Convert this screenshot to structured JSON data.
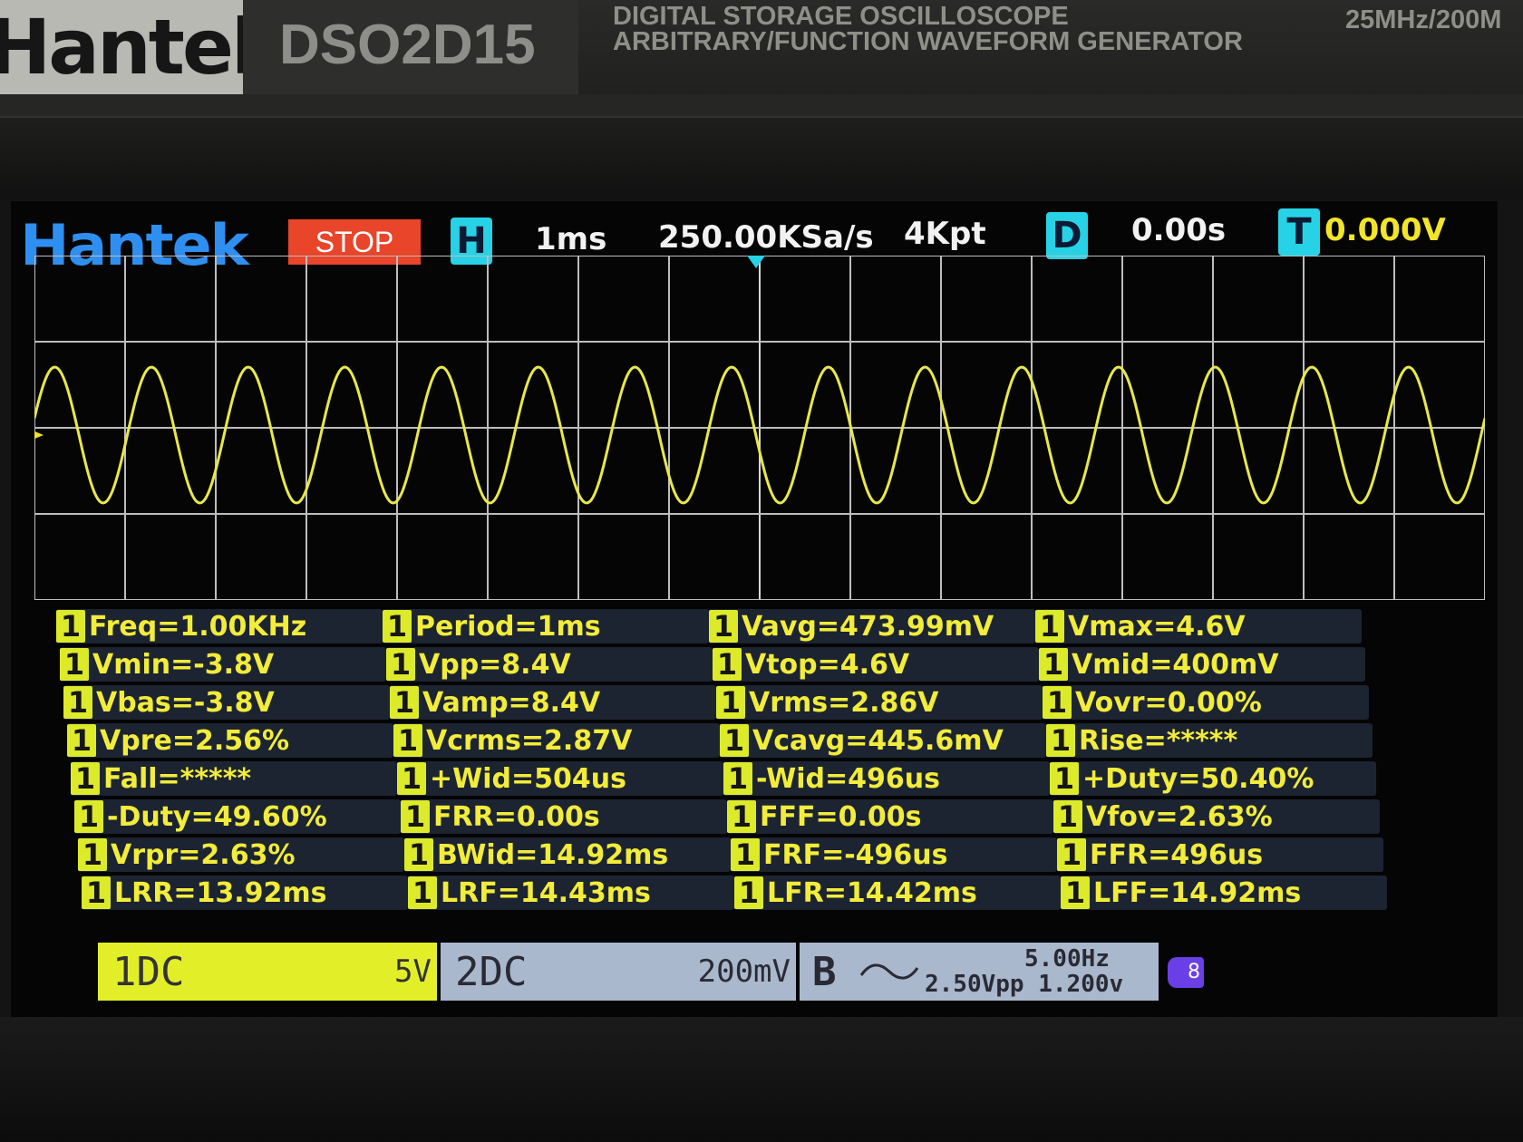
{
  "device": {
    "brand": "Hantek",
    "model": "DSO2D15",
    "subtitle_line1": "DIGITAL STORAGE OSCILLOSCOPE",
    "subtitle_line2": "ARBITRARY/FUNCTION WAVEFORM GENERATOR",
    "spec_right": "25MHz/200M"
  },
  "status_bar": {
    "logo": "Hantek",
    "run_state": "STOP",
    "horizontal_chip": "H",
    "timebase": "1ms",
    "sample_rate": "250.00KSa/s",
    "memory_depth": "4Kpt",
    "delay_chip": "D",
    "delay": "0.00s",
    "trigger_chip": "T",
    "trigger_level": "0.000V"
  },
  "waveform": {
    "channel": "1",
    "shape": "sine",
    "color": "#e8e84a",
    "cycles_visible": 15,
    "trigger_marker": "T"
  },
  "measurements": {
    "channel_badge": "1",
    "columns": [
      [
        "Freq=1.00KHz",
        "Vmin=-3.8V",
        "Vbas=-3.8V",
        "Vpre=2.56%",
        "Fall=*****",
        "-Duty=49.60%",
        "Vrpr=2.63%",
        "LRR=13.92ms"
      ],
      [
        "Period=1ms",
        "Vpp=8.4V",
        "Vamp=8.4V",
        "Vcrms=2.87V",
        "+Wid=504us",
        "FRR=0.00s",
        "BWid=14.92ms",
        "LRF=14.43ms"
      ],
      [
        "Vavg=473.99mV",
        "Vtop=4.6V",
        "Vrms=2.86V",
        "Vcavg=445.6mV",
        "-Wid=496us",
        "FFF=0.00s",
        "FRF=-496us",
        "LFR=14.42ms"
      ],
      [
        "Vmax=4.6V",
        "Vmid=400mV",
        "Vovr=0.00%",
        "Rise=*****",
        "+Duty=50.40%",
        "Vfov=2.63%",
        "FFR=496us",
        "LFF=14.92ms"
      ]
    ]
  },
  "channels": {
    "ch1": {
      "name": "1DC",
      "scale": "5V"
    },
    "ch2": {
      "name": "2DC",
      "scale": "200mV"
    },
    "generator": {
      "name": "B",
      "frequency": "5.00Hz",
      "amplitude": "2.50Vpp",
      "offset": "1.200v"
    }
  },
  "usb_indicator": "8",
  "colors": {
    "logo": "#2f8ff0",
    "stop": "#e8452a",
    "chip": "#27d2e6",
    "trace": "#e8e84a",
    "measure_text": "#f2ec3a",
    "ch1_bar": "#e2ef28",
    "ch2_bar": "#a9b8cc"
  }
}
